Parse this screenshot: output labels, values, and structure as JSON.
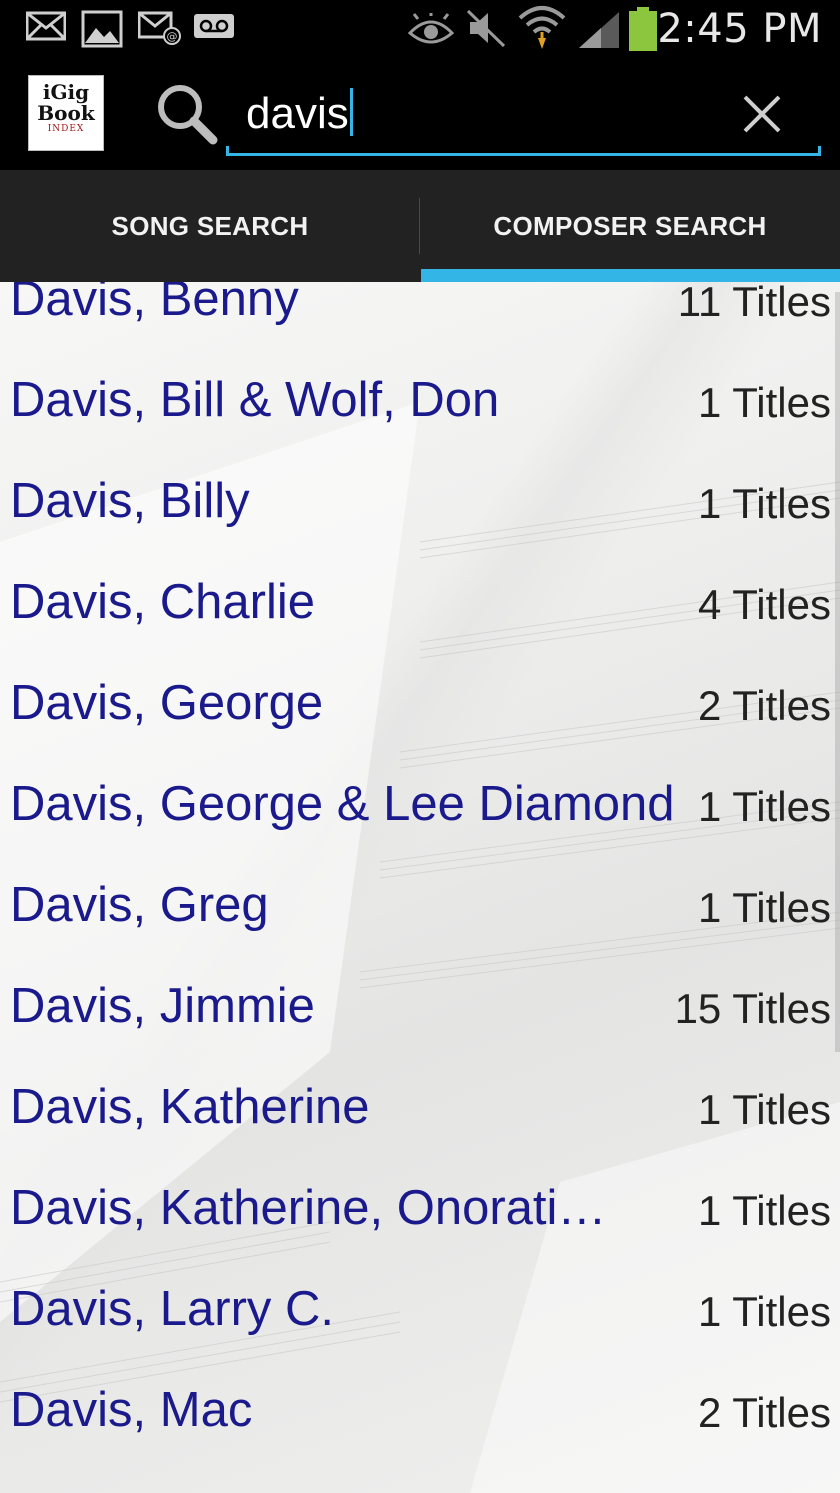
{
  "status_bar": {
    "time": "2:45 PM",
    "left_icons": [
      "email-icon",
      "image-icon",
      "email-alert-icon",
      "voicemail-icon"
    ],
    "right_icons": [
      "eye-icon",
      "mute-icon",
      "wifi-icon",
      "signal-icon",
      "battery-icon"
    ],
    "battery_color": "#8cc63f"
  },
  "action_bar": {
    "logo": {
      "line1": "iGig",
      "line2": "Book",
      "line3": "INDEX"
    },
    "search": {
      "value": "davis",
      "accent": "#33b5e5"
    }
  },
  "tabs": [
    {
      "label": "SONG SEARCH",
      "selected": false
    },
    {
      "label": "COMPOSER SEARCH",
      "selected": true
    }
  ],
  "results": [
    {
      "name": "Davis, Benny",
      "count": "11 Titles"
    },
    {
      "name": "Davis, Bill & Wolf, Don",
      "count": "1 Titles"
    },
    {
      "name": "Davis, Billy",
      "count": "1 Titles"
    },
    {
      "name": "Davis, Charlie",
      "count": "4 Titles"
    },
    {
      "name": "Davis, George",
      "count": "2 Titles"
    },
    {
      "name": "Davis, George & Lee Diamond",
      "count": "1 Titles"
    },
    {
      "name": "Davis, Greg",
      "count": "1 Titles"
    },
    {
      "name": "Davis, Jimmie",
      "count": "15 Titles"
    },
    {
      "name": "Davis, Katherine",
      "count": "1 Titles"
    },
    {
      "name": "Davis, Katherine, Onorati,…",
      "count": "1 Titles"
    },
    {
      "name": "Davis, Larry C.",
      "count": "1 Titles"
    },
    {
      "name": "Davis, Mac",
      "count": "2 Titles"
    }
  ],
  "colors": {
    "name_text": "#1a1a8c",
    "tab_bar": "#222222",
    "indicator": "#33b5e5"
  }
}
